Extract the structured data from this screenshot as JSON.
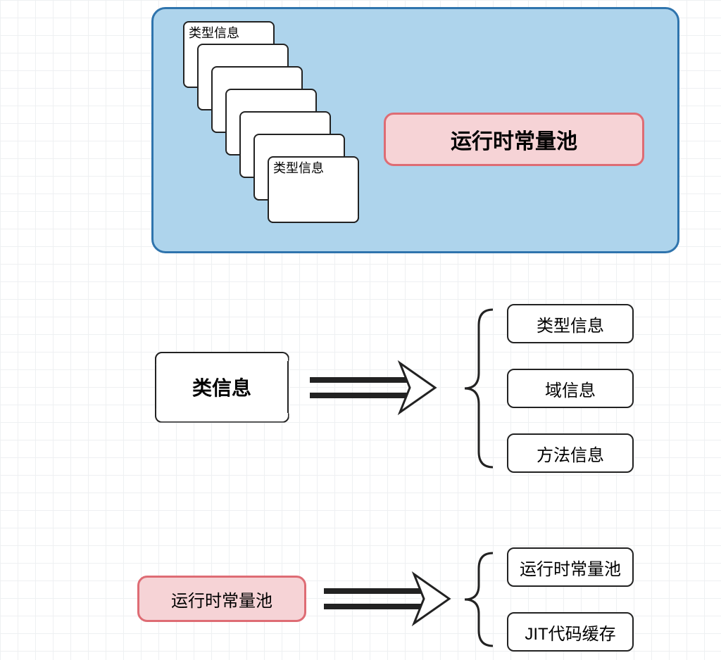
{
  "top": {
    "stack_label_first": "类型信息",
    "stack_label_last": "类型信息",
    "runtime_const_pool": "运行时常量池"
  },
  "middle": {
    "class_info": "类信息",
    "items": [
      "类型信息",
      "域信息",
      "方法信息"
    ]
  },
  "bottom": {
    "runtime_const_pool": "运行时常量池",
    "items": [
      "运行时常量池",
      "JIT代码缓存"
    ]
  }
}
